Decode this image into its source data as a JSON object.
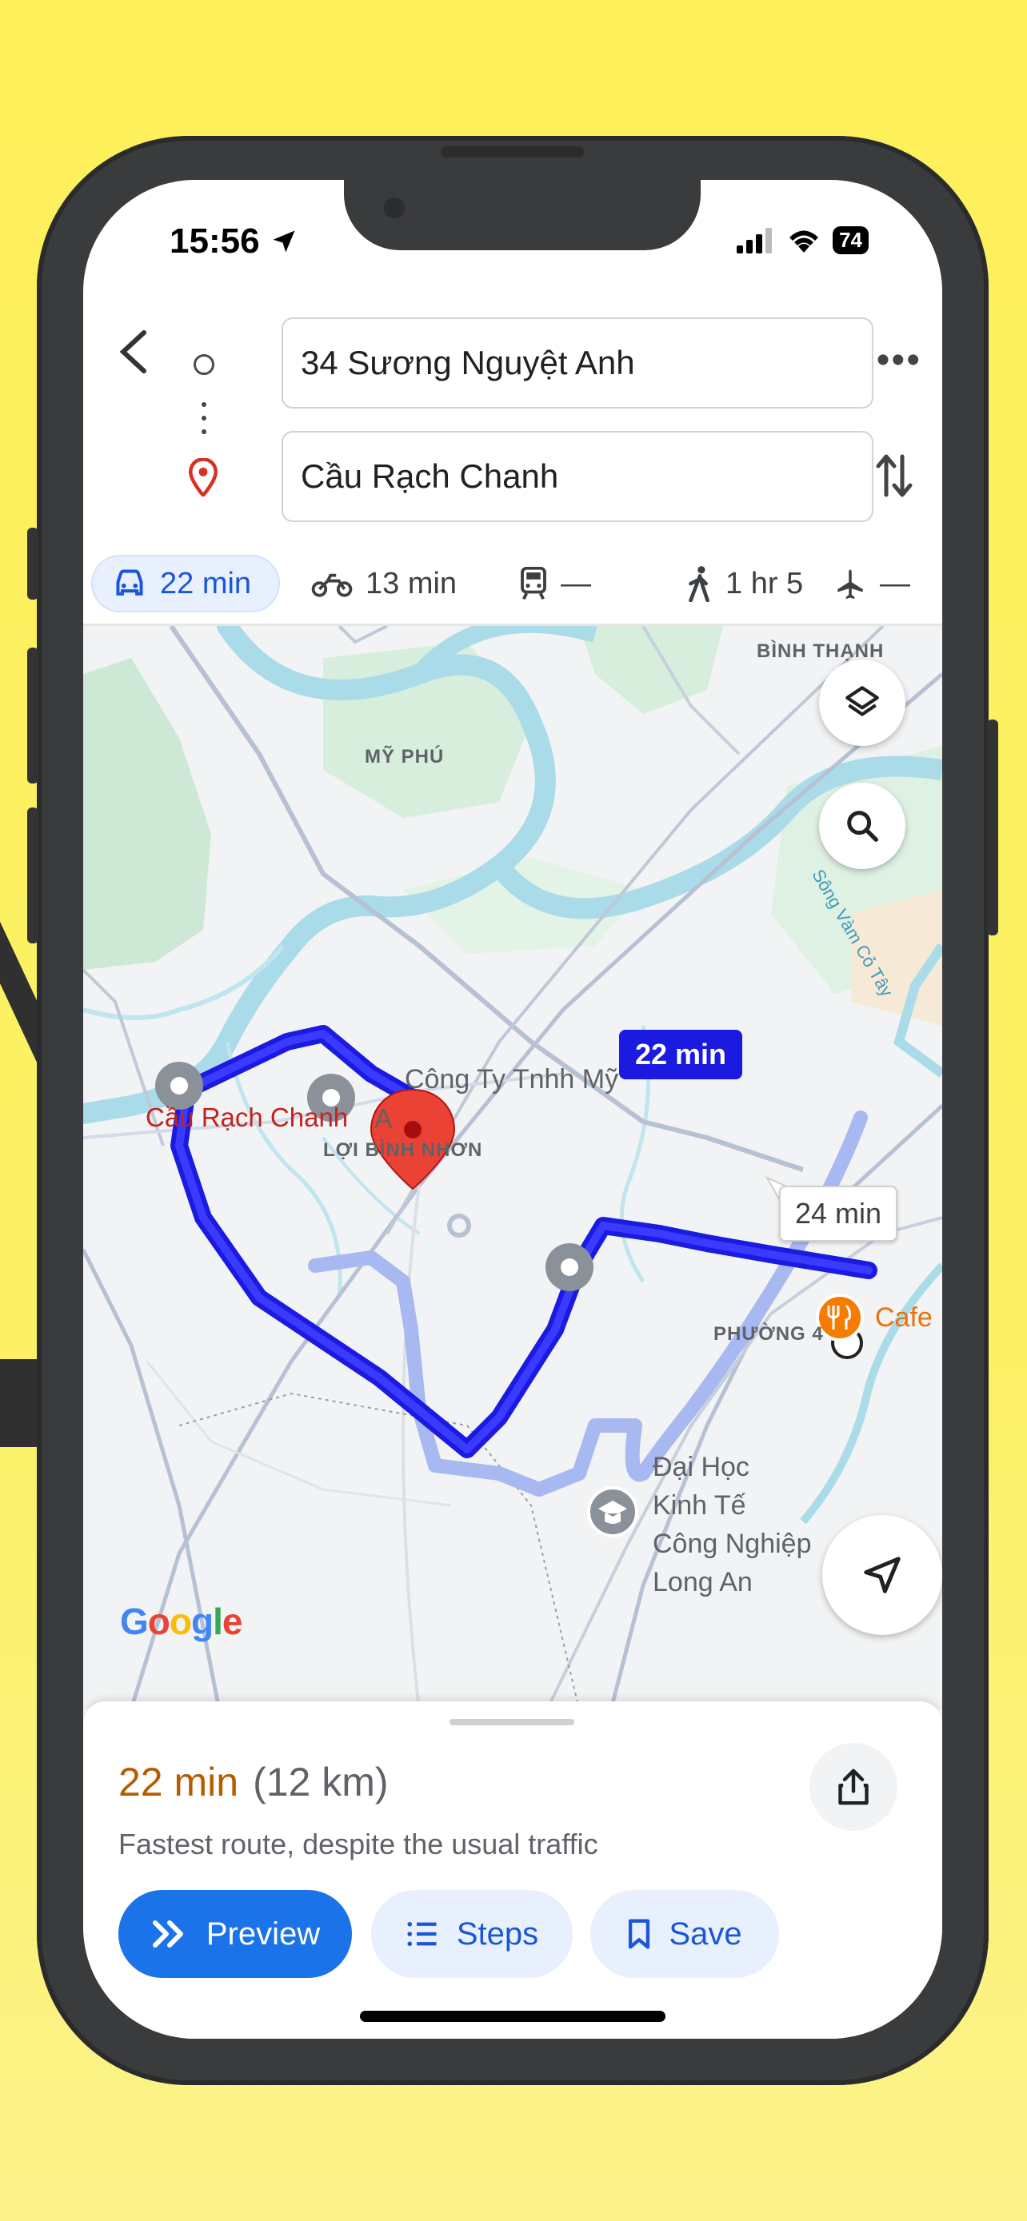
{
  "status_bar": {
    "time": "15:56",
    "battery": "74"
  },
  "search": {
    "origin_value": "34 Sương Nguyệt Anh",
    "destination_value": "Cầu Rạch Chanh"
  },
  "modes": [
    {
      "label": "22 min",
      "icon": "car-icon",
      "active": true
    },
    {
      "label": "13 min",
      "icon": "motorbike-icon",
      "active": false
    },
    {
      "label": "—",
      "icon": "transit-icon",
      "active": false
    },
    {
      "label": "1 hr 5",
      "icon": "walk-icon",
      "active": false
    },
    {
      "label": "—",
      "icon": "flight-icon",
      "active": false
    }
  ],
  "map": {
    "areas": [
      "BÌNH THẠNH",
      "MỸ PHÚ",
      "LỢI BÌNH NHƠN",
      "PHƯỜNG 4"
    ],
    "places": {
      "destination": "Cầu Rạch Chanh",
      "company": "Công Ty Tnhh Mỹ",
      "company_suffix": "A",
      "cafe": "Cafe",
      "university_line1": "Đại Học",
      "university_line2": "Kinh Tế",
      "university_line3": "Công Nghiệp",
      "university_line4": "Long An"
    },
    "river": "Sông Vàm Cỏ Tây",
    "route_active_label": "22 min",
    "route_alt_label": "24 min",
    "logo": "Google"
  },
  "sheet": {
    "duration": "22 min",
    "distance": "(12 km)",
    "description": "Fastest route, despite the usual traffic",
    "preview_label": "Preview",
    "steps_label": "Steps",
    "save_label": "Save"
  },
  "colors": {
    "background": "#fdf05a",
    "route_active": "#1a1ae0",
    "route_alt": "#a8b8f0",
    "water": "#a9dbe9",
    "park": "#c9ead3",
    "accent": "#1a73e8",
    "duration": "#b65c00",
    "destination_pin": "#ea4335",
    "cafe_pin": "#f57c00"
  }
}
